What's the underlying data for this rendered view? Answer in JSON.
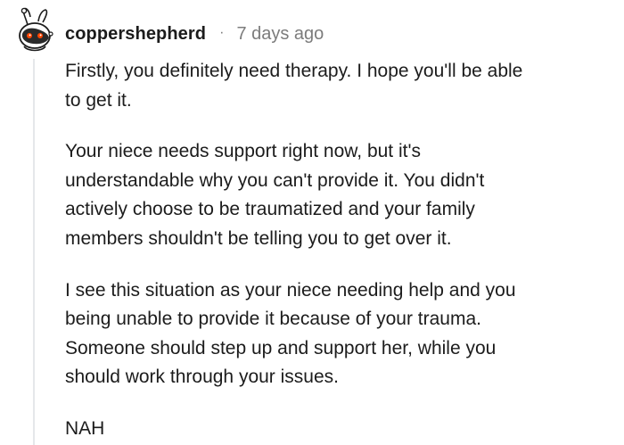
{
  "comment": {
    "username": "coppershepherd",
    "separator": "·",
    "timestamp": "7 days ago",
    "avatar_icon": "snoo-avatar-icon",
    "paragraphs": [
      [
        "Firstly, you definitely need therapy. I hope you'll be able",
        "to get it."
      ],
      [
        "Your niece needs support right now, but it's",
        "understandable why you can't provide it. You didn't",
        "actively choose to be traumatized and your family",
        "members shouldn't be telling you to get over it."
      ],
      [
        "I see this situation as your niece needing help and you",
        "being unable to provide it because of your trauma.",
        "Someone should step up and support her, while you",
        "should work through your issues."
      ],
      [
        "NAH"
      ]
    ]
  },
  "colors": {
    "text": "#1c1c1c",
    "meta": "#7c7c7c",
    "thread_line": "#e5e7ea",
    "avatar_accent": "#ff4500"
  }
}
